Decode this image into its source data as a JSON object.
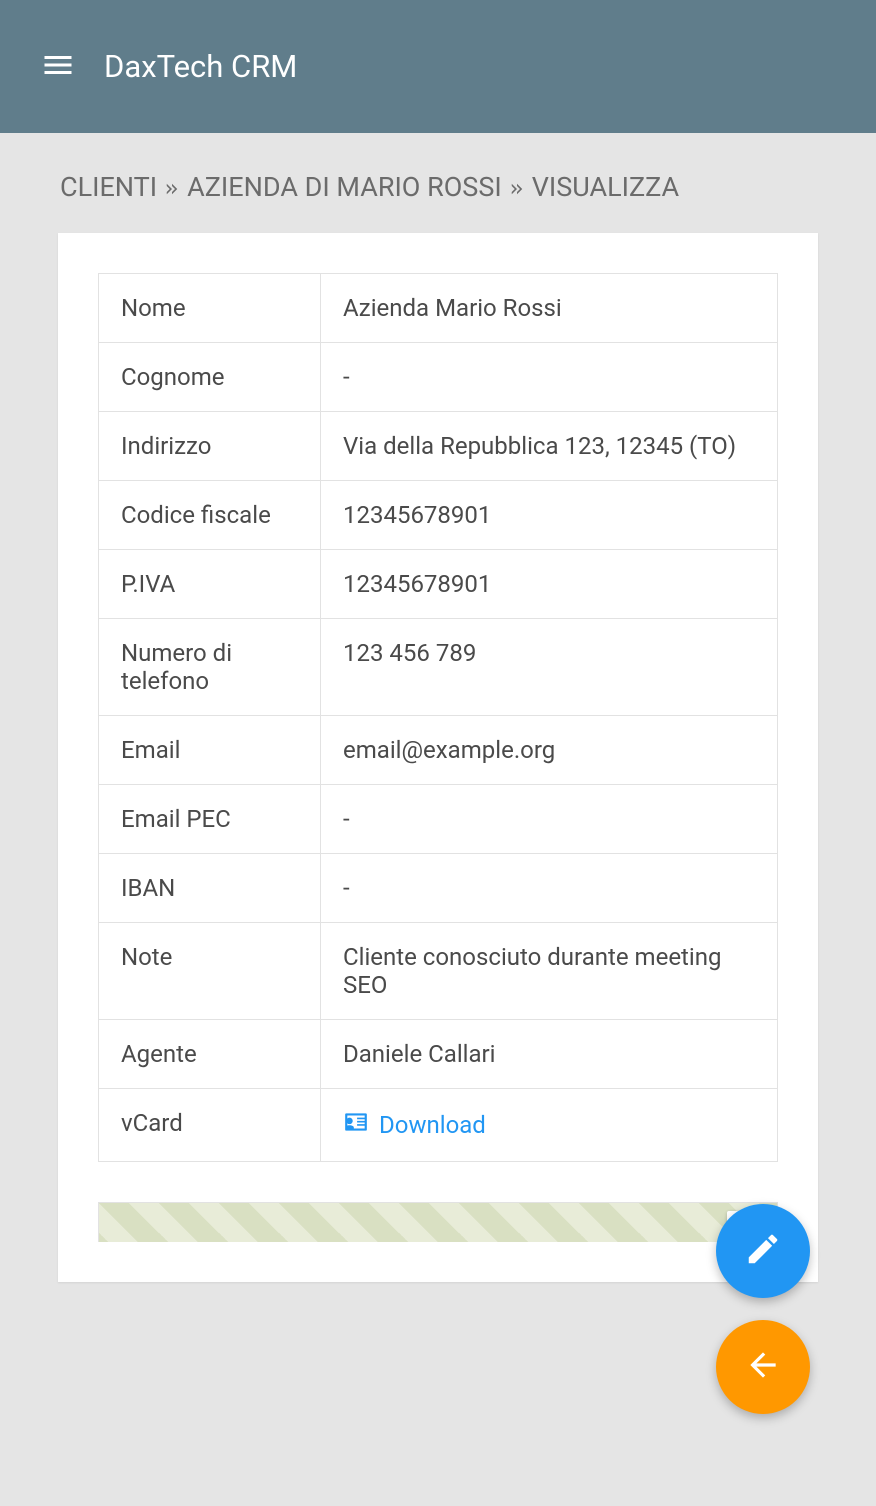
{
  "header": {
    "title": "DaxTech CRM"
  },
  "breadcrumb": {
    "items": [
      "CLIENTI",
      "AZIENDA DI MARIO ROSSI",
      "VISUALIZZA"
    ]
  },
  "details": {
    "rows": [
      {
        "label": "Nome",
        "value": "Azienda Mario Rossi"
      },
      {
        "label": "Cognome",
        "value": "-"
      },
      {
        "label": "Indirizzo",
        "value": "Via della Repubblica 123, 12345 (TO)"
      },
      {
        "label": "Codice fiscale",
        "value": "12345678901"
      },
      {
        "label": "P.IVA",
        "value": "12345678901"
      },
      {
        "label": "Numero di telefono",
        "value": "123 456 789"
      },
      {
        "label": "Email",
        "value": "email@example.org"
      },
      {
        "label": "Email PEC",
        "value": "-"
      },
      {
        "label": "IBAN",
        "value": "-"
      },
      {
        "label": "Note",
        "value": "Cliente conosciuto durante meeting SEO"
      },
      {
        "label": "Agente",
        "value": "Daniele Callari"
      }
    ],
    "vcard": {
      "label": "vCard",
      "link_text": "Download"
    }
  }
}
